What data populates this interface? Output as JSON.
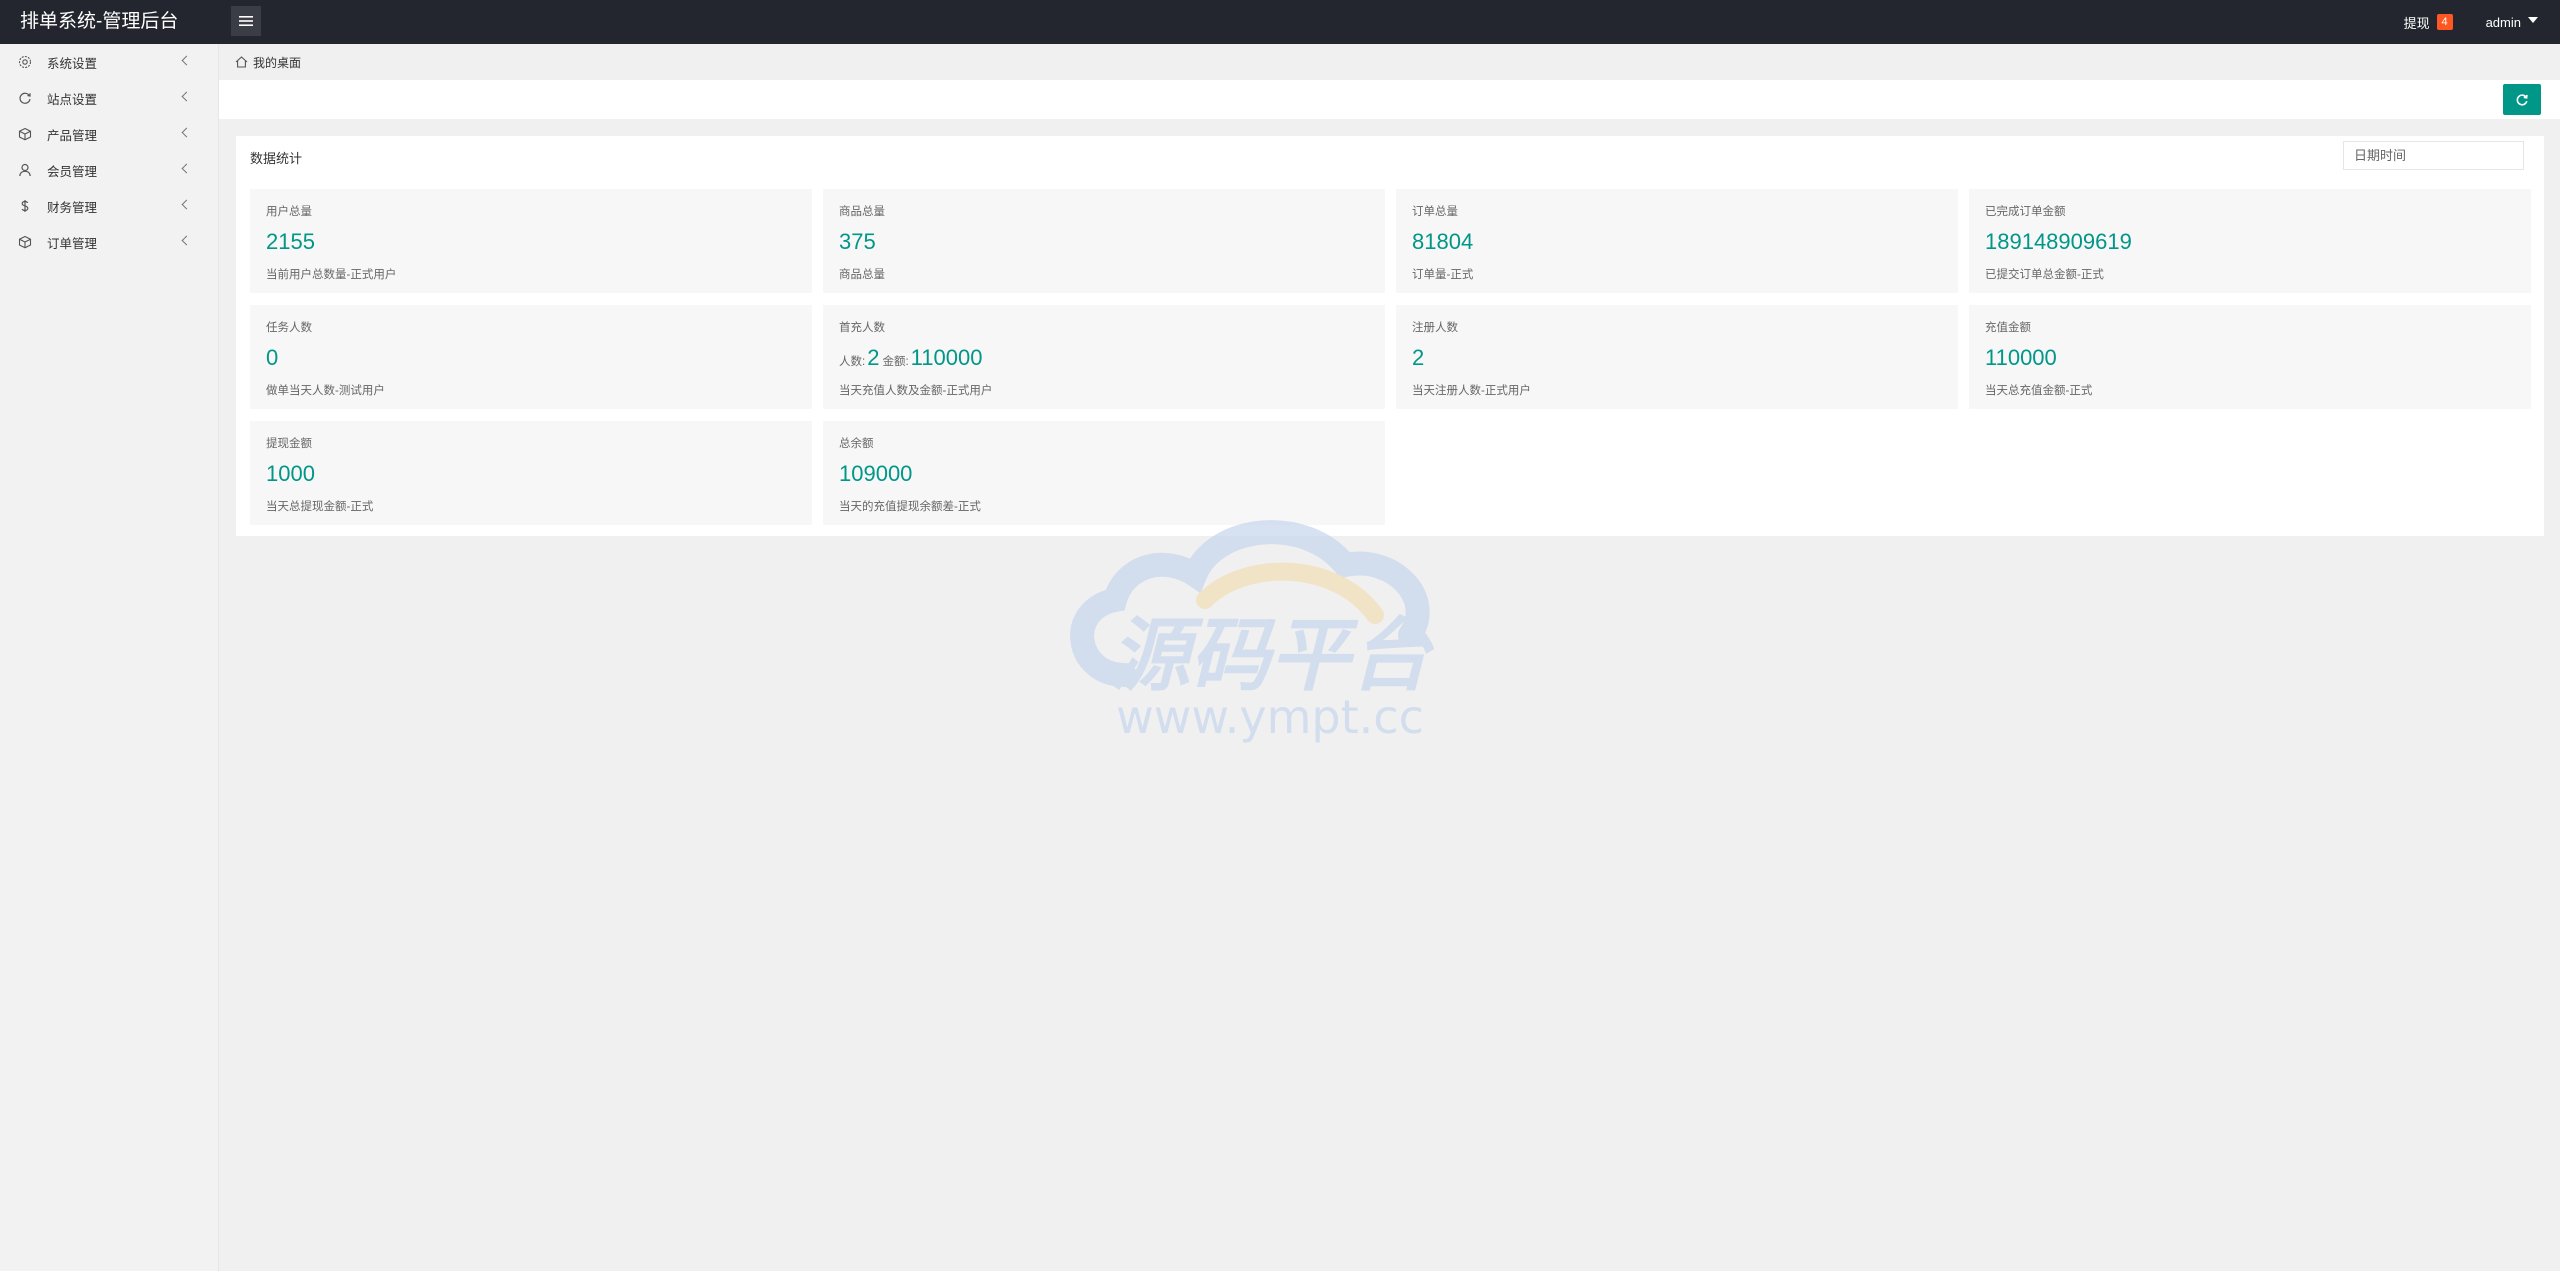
{
  "header": {
    "brand": "排单系统-管理后台",
    "withdraw_label": "提现",
    "withdraw_badge": "4",
    "user_name": "admin"
  },
  "sidebar": {
    "items": [
      {
        "label": "系统设置",
        "icon": "gear-icon"
      },
      {
        "label": "站点设置",
        "icon": "refresh-icon"
      },
      {
        "label": "产品管理",
        "icon": "cube-icon"
      },
      {
        "label": "会员管理",
        "icon": "user-icon"
      },
      {
        "label": "财务管理",
        "icon": "dollar-icon"
      },
      {
        "label": "订单管理",
        "icon": "cube-icon"
      }
    ]
  },
  "breadcrumb": {
    "label": "我的桌面"
  },
  "panel": {
    "title": "数据统计",
    "date_placeholder": "日期时间"
  },
  "cards": [
    {
      "label": "用户总量",
      "value": "2155",
      "desc": "当前用户总数量-正式用户"
    },
    {
      "label": "商品总量",
      "value": "375",
      "desc": "商品总量"
    },
    {
      "label": "订单总量",
      "value": "81804",
      "desc": "订单量-正式"
    },
    {
      "label": "已完成订单金额",
      "value": "189148909619",
      "desc": "已提交订单总金额-正式"
    },
    {
      "label": "任务人数",
      "value": "0",
      "desc": "做单当天人数-测试用户"
    },
    {
      "label": "首充人数",
      "count_label": "人数:",
      "count": "2",
      "amount_label": "金额:",
      "amount": "110000",
      "desc": "当天充值人数及金额-正式用户"
    },
    {
      "label": "注册人数",
      "value": "2",
      "desc": "当天注册人数-正式用户"
    },
    {
      "label": "充值金额",
      "value": "110000",
      "desc": "当天总充值金额-正式"
    },
    {
      "label": "提现金额",
      "value": "1000",
      "desc": "当天总提现金额-正式"
    },
    {
      "label": "总余额",
      "value": "109000",
      "desc": "当天的充值提现余额差-正式"
    }
  ],
  "watermark": {
    "title": "源码平台",
    "url": "www.ympt.cc"
  },
  "colors": {
    "accent": "#009688",
    "header_bg": "#23262e",
    "badge": "#ff5722"
  }
}
